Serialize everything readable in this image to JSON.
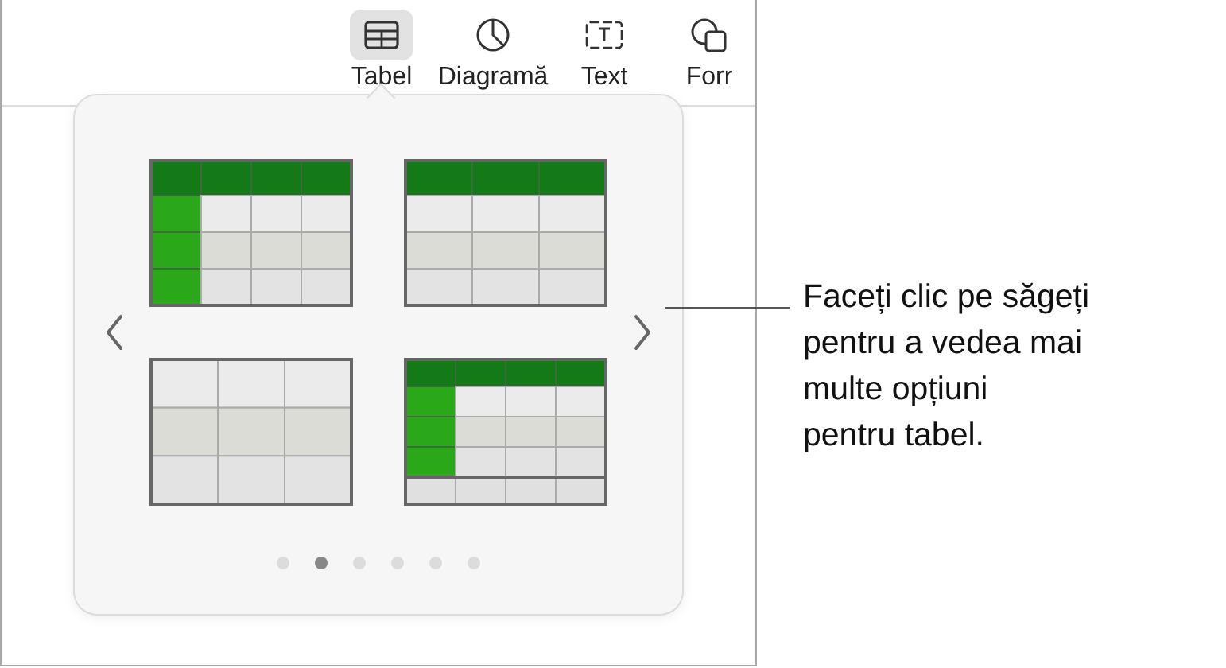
{
  "toolbar": {
    "items": [
      {
        "kind": "table",
        "label": "Tabel",
        "selected": true
      },
      {
        "kind": "chart",
        "label": "Diagramă",
        "selected": false
      },
      {
        "kind": "text",
        "label": "Text",
        "selected": false
      },
      {
        "kind": "shape",
        "label": "Forr",
        "selected": false
      }
    ]
  },
  "popover": {
    "styles": [
      {
        "kind": "header-both"
      },
      {
        "kind": "header-row"
      },
      {
        "kind": "plain"
      },
      {
        "kind": "header-both-footer"
      }
    ],
    "pages": [
      {
        "selected": false
      },
      {
        "selected": true
      },
      {
        "selected": false
      },
      {
        "selected": false
      },
      {
        "selected": false
      },
      {
        "selected": false
      }
    ]
  },
  "callout": "Faceți clic pe săgeți\npentru a vedea mai\nmulte opțiuni\npentru tabel."
}
